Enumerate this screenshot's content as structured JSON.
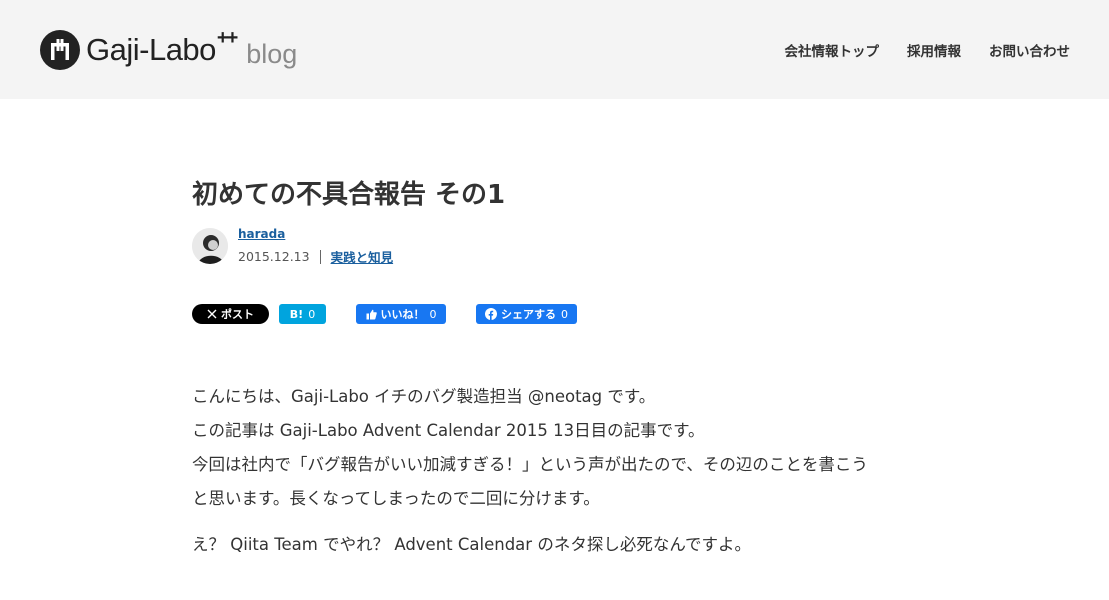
{
  "site": {
    "logo_text": "Gaji-Labo",
    "logo_plus": "++",
    "logo_blog": "blog"
  },
  "nav": {
    "items": [
      {
        "label": "会社情報トップ"
      },
      {
        "label": "採用情報"
      },
      {
        "label": "お問い合わせ"
      }
    ]
  },
  "post": {
    "title": "初めての不具合報告 その1",
    "author": "harada",
    "date": "2015.12.13",
    "category": "実践と知見"
  },
  "share": {
    "x_label": "ポスト",
    "hatena_label": "B!",
    "hatena_count": "0",
    "like_label": "いいね！",
    "like_count": "0",
    "fb_share_label": "シェアする",
    "fb_share_count": "0"
  },
  "body": {
    "lines": [
      "こんにちは、Gaji-Labo イチのバグ製造担当 @neotag です。",
      "この記事は Gaji-Labo Advent Calendar 2015 13日目の記事です。",
      "今回は社内で「バグ報告がいい加減すぎる！」という声が出たので、その辺のことを書こう",
      "と思います。長くなってしまったので二回に分けます。",
      "え？ Qiita Team でやれ？ Advent Calendar のネタ探し必死なんですよ。"
    ]
  },
  "colors": {
    "header_bg": "#f4f4f4",
    "link": "#1a5f9e",
    "x_button": "#000000",
    "hatena_button": "#00a4de",
    "facebook_button": "#1877f2"
  }
}
